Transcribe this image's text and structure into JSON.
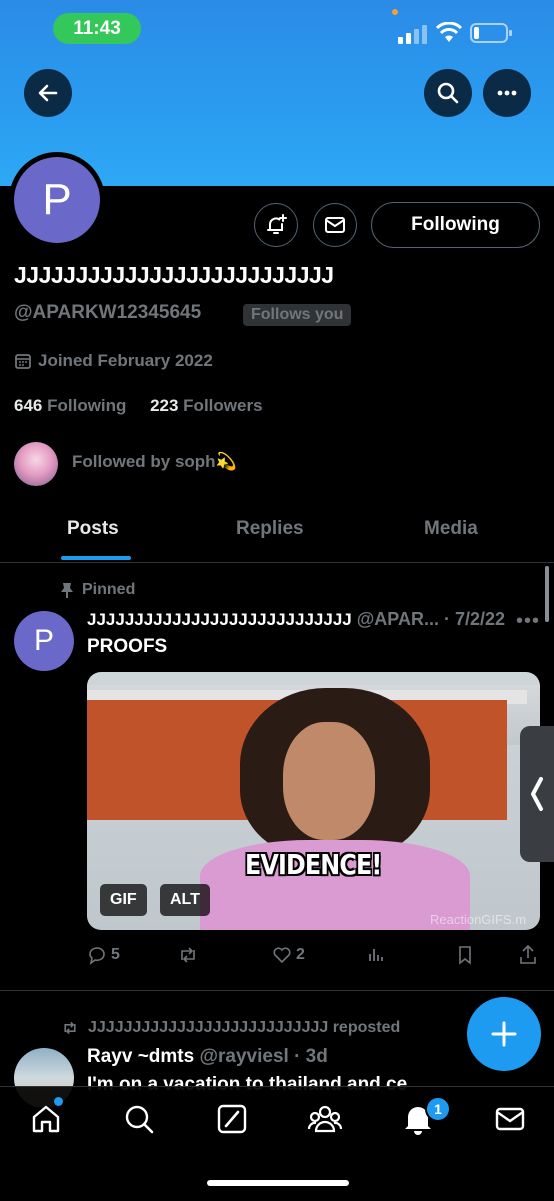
{
  "status_bar": {
    "time": "11:43"
  },
  "profile": {
    "avatar_letter": "P",
    "display_name": "JJJJJJJJJJJJJJJJJJJJJJJJJJ",
    "handle": "@APARKW12345645",
    "follows_you": "Follows you",
    "joined": "Joined February 2022",
    "following_count": "646",
    "following_label": "Following",
    "followers_count": "223",
    "followers_label": "Followers",
    "followed_by": "Followed by soph💫",
    "follow_button": "Following"
  },
  "tabs": [
    {
      "label": "Posts",
      "active": true
    },
    {
      "label": "Replies"
    },
    {
      "label": "Media"
    }
  ],
  "pinned_post": {
    "pinned_label": "Pinned",
    "avatar_letter": "P",
    "author": "JJJJJJJJJJJJJJJJJJJJJJJJJJJJ",
    "handle_date": "@APAR... · 7/2/22",
    "text": "PROOFS",
    "media_caption": "EVIDENCE!",
    "gif_label": "GIF",
    "alt_label": "ALT",
    "watermark": "ReactionGIFS.m",
    "replies": "5",
    "likes": "2"
  },
  "repost": {
    "repost_line": "JJJJJJJJJJJJJJJJJJJJJJJJJJJ reposted",
    "author": "Rayv ~dmts",
    "handle_date": "@rayviesl · 3d",
    "text": "I'm on a vacation to thailand and ce"
  },
  "bottom_nav": {
    "notifications_badge": "1"
  },
  "colors": {
    "accent": "#1d9bf0",
    "banner": "#2a9cf0",
    "background": "#000000"
  }
}
